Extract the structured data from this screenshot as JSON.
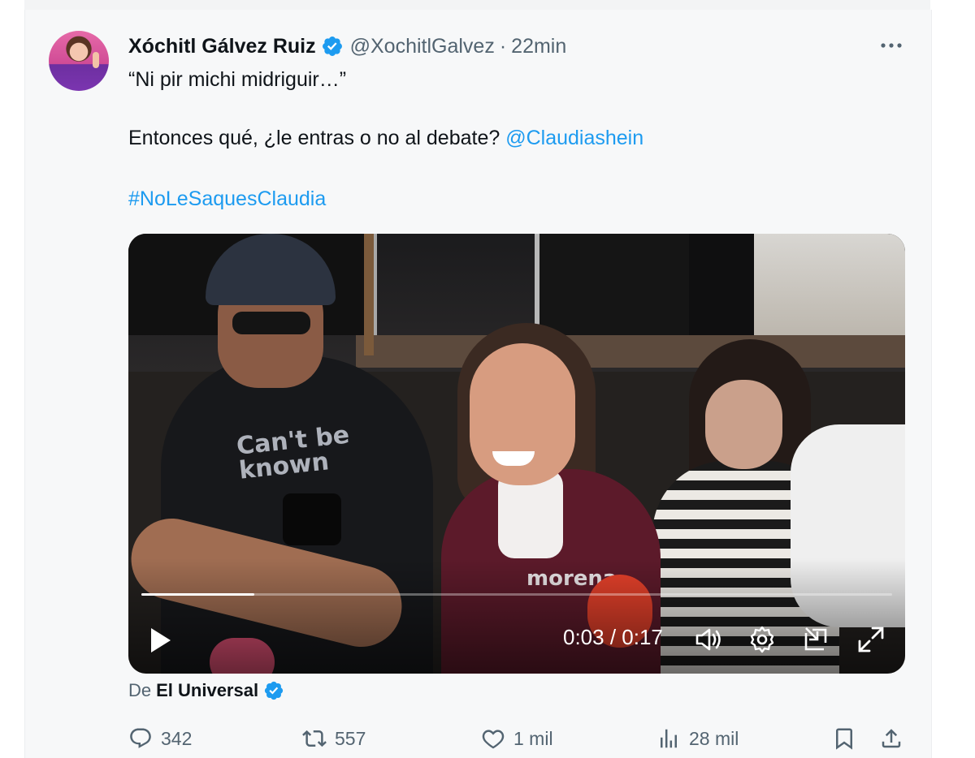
{
  "tweet": {
    "author": {
      "display_name": "Xóchitl Gálvez Ruiz",
      "handle": "@XochitlGalvez",
      "separator": "·",
      "time": "22min",
      "verified": true
    },
    "text": {
      "line1": "“Ni pir michi midriguir…”",
      "line2_text": "Entonces qué, ¿le entras o no al debate? ",
      "line2_mention": "@Claudiashein",
      "hashtag": "#NoLeSaquesClaudia"
    },
    "video": {
      "time_display": "0:03 / 0:17",
      "progress_fraction": 0.15,
      "shirt_print": "Can't be known",
      "vest_print": "morena"
    },
    "source": {
      "prefix": "De",
      "name": "El Universal",
      "verified": true
    },
    "actions": {
      "replies": "342",
      "retweets": "557",
      "likes": "1 mil",
      "views": "28 mil"
    }
  },
  "colors": {
    "link": "#1d9bf0",
    "verified_badge": "#1d9bf0",
    "secondary_text": "#536471",
    "primary_text": "#0f1419",
    "card_background": "#f7f8f9"
  },
  "icons": [
    "verified-badge-icon",
    "more-options-icon",
    "play-icon",
    "volume-icon",
    "settings-icon",
    "pop-out-icon",
    "fullscreen-icon",
    "reply-icon",
    "retweet-icon",
    "like-icon",
    "views-icon",
    "bookmark-icon",
    "share-icon"
  ]
}
